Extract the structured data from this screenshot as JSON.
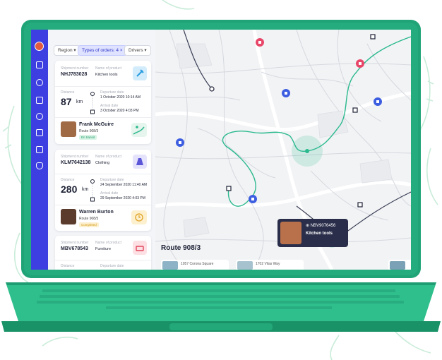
{
  "colors": {
    "laptop_body": "#1fa377",
    "laptop_light": "#2fbf8c",
    "sidebar": "#3d3fe0",
    "route": "#2bb98e",
    "accent": "#3d5ee0"
  },
  "filters": {
    "region": "Region",
    "types": "Types of orders: 4",
    "drivers": "Drivers"
  },
  "shipments": [
    {
      "shipment_label": "Shipment number",
      "shipment_number": "NHJ783028",
      "product_label": "Name of product",
      "product": "Kitchen tools",
      "distance_label": "Distance",
      "distance": "87",
      "unit": "km",
      "departure_label": "Departure date",
      "departure": "1 October 2020 10:14 AM",
      "arrival_label": "Arrival date",
      "arrival": "3 October 2020 4:03 PM",
      "driver": "Frank McGuire",
      "route": "Route 908/3",
      "status": "En transit"
    },
    {
      "shipment_label": "Shipment number",
      "shipment_number": "KLM7642138",
      "product_label": "Name of product",
      "product": "Clothing",
      "distance_label": "Distance",
      "distance": "280",
      "unit": "km",
      "departure_label": "Departure date",
      "departure": "24 September 2020 11:40 AM",
      "arrival_label": "Arrival date",
      "arrival": "29 September 2020 4:03 PM",
      "driver": "Warren Burton",
      "route": "Route 908/5",
      "status": "Completed"
    },
    {
      "shipment_label": "Shipment number",
      "shipment_number": "MBV678543",
      "product_label": "Name of product",
      "product": "Furniture",
      "distance_label": "Distance",
      "departure_label": "Departure date"
    }
  ],
  "map": {
    "route_title": "Route 908/3",
    "stops": [
      {
        "address": "1057 Corona Square"
      },
      {
        "address": "1702 Vilas Way"
      }
    ],
    "tooltip": {
      "id": "NBV9076456",
      "product": "Kitchen tools"
    }
  }
}
